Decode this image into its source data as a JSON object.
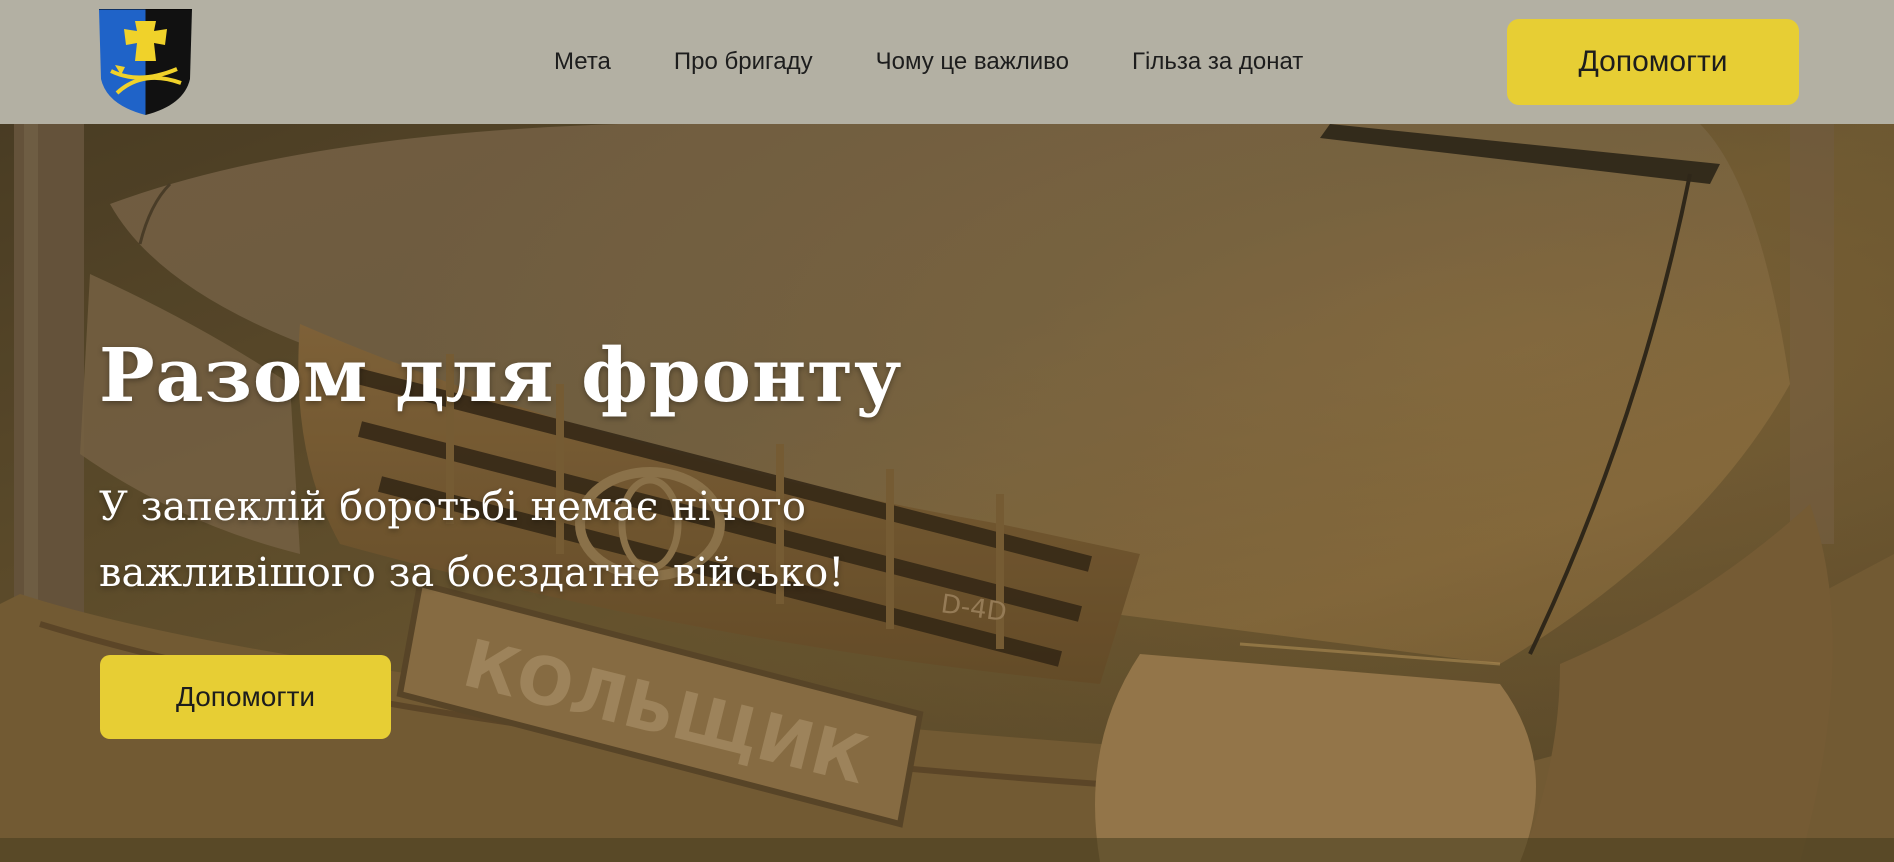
{
  "header": {
    "logo": {
      "icon": "brigade-shield-logo-icon",
      "colors": {
        "left": "#1f63c8",
        "right": "#111111",
        "emblem": "#f0d22a"
      }
    },
    "nav": [
      {
        "label": "Мета"
      },
      {
        "label": "Про бригаду"
      },
      {
        "label": "Чому це важливо"
      },
      {
        "label": "Гільза за донат"
      }
    ],
    "cta_label": "Допомогти"
  },
  "hero": {
    "title": "Разом для фронту",
    "subtitle_line1": "У запеклій боротьбі немає нічого",
    "subtitle_line2": "важливішого за боєздатне військо!",
    "cta_label": "Допомогти",
    "background": {
      "description_icon": "muddy-vehicle-photo",
      "plate_text": "КОЛЬЩИК",
      "badge_text": "D-4D"
    }
  },
  "colors": {
    "header_bg": "#b3b0a3",
    "accent_yellow": "#e7ce34",
    "text_dark": "#1d1d1d",
    "hero_text": "#ffffff"
  }
}
